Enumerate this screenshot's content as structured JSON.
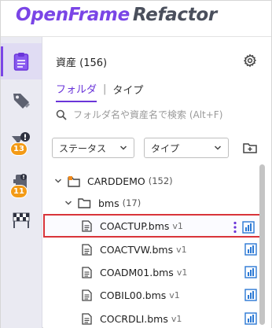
{
  "header": {
    "brand_part1": "OpenFrame",
    "brand_part2": "Refactor"
  },
  "rail": {
    "items": [
      {
        "icon": "clipboard-icon",
        "active": true
      },
      {
        "icon": "tag-icon",
        "active": false
      },
      {
        "icon": "funnel-alert-icon",
        "badge": "13"
      },
      {
        "icon": "device-pin-icon",
        "badge": "11"
      },
      {
        "icon": "race-flag-icon",
        "active": false
      }
    ]
  },
  "panel": {
    "title": "資産 (156)",
    "tabs": {
      "folder": "フォルダ",
      "separator": "|",
      "type": "タイプ"
    },
    "search": {
      "placeholder": "フォルダ名や資産名で検索 (Alt+F)",
      "value": ""
    },
    "filters": {
      "status": "ステータス",
      "type": "タイプ"
    }
  },
  "tree": {
    "root": {
      "name": "CARDDEMO",
      "count": "(152)"
    },
    "folder": {
      "name": "bms",
      "count": "(17)"
    },
    "files": [
      {
        "name": "COACTUP.bms",
        "version": "v1",
        "selected": true
      },
      {
        "name": "COACTVW.bms",
        "version": "v1",
        "selected": false
      },
      {
        "name": "COADM01.bms",
        "version": "v1",
        "selected": false
      },
      {
        "name": "COBIL00.bms",
        "version": "v1",
        "selected": false
      },
      {
        "name": "COCRDLI.bms",
        "version": "v1",
        "selected": false
      }
    ]
  },
  "colors": {
    "accent": "#7a45e6",
    "chart_icon": "#2a78d4",
    "badge": "#f39a16",
    "folder_dot": "#f08a1c",
    "selection_border": "#d9343a"
  }
}
